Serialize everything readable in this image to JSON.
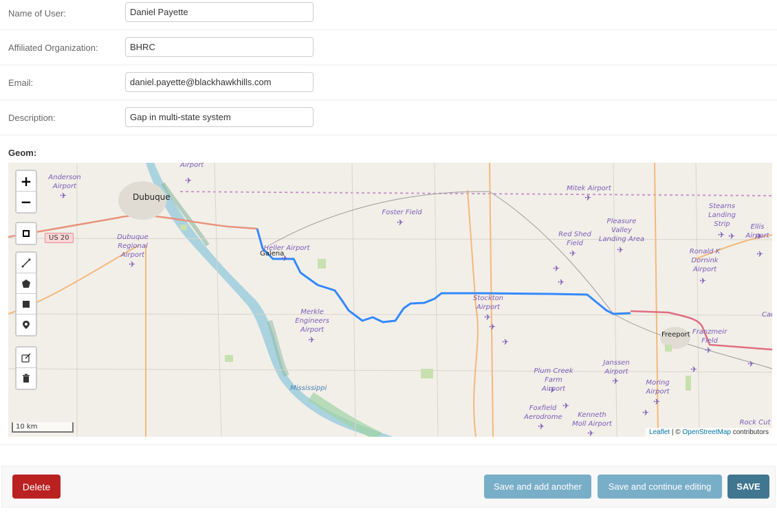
{
  "form": {
    "name": {
      "label": "Name of User:",
      "value": "Daniel Payette"
    },
    "org": {
      "label": "Affiliated Organization:",
      "value": "BHRC"
    },
    "email": {
      "label": "Email:",
      "value": "daniel.payette@blackhawkhills.com"
    },
    "description": {
      "label": "Description:",
      "value": "Gap in multi-state system"
    },
    "geom_label": "Geom:"
  },
  "map": {
    "controls": {
      "zoom_in": "+",
      "zoom_out": "−",
      "icons": [
        "rectangle-outline-icon",
        "draw-polyline-icon",
        "draw-polygon-icon",
        "draw-rectangle-icon",
        "draw-marker-icon",
        "edit-layers-icon",
        "delete-layers-icon"
      ]
    },
    "route_color": "#3388ff",
    "cities": {
      "dubuque": "Dubuque",
      "freeport": "Freeport",
      "galena": "Galena"
    },
    "road_shield": "US 20",
    "river": "Mississippi",
    "places": {
      "anderson": "Anderson Airport",
      "dubuque_regional": "Dubuque Regional Airport",
      "heller": "Heller Airport",
      "foster": "Foster Field",
      "mitek": "Mitek Airport",
      "stearns": "Stearns Landing Strip",
      "ellis": "Ellis Airport",
      "red_shed": "Red Shed Field",
      "pleasure_valley": "Pleasure Valley Landing Area",
      "ronald": "Ronald K Dornink Airport",
      "merkle": "Merkle Engineers Airport",
      "stockton": "Stockton Airport",
      "franzmeir": "Franzmeir Field",
      "car": "Car",
      "plum_creek": "Plum Creek Farm Airport",
      "jansen": "Janssen Airport",
      "moring": "Moring Airport",
      "foxfield": "Foxfield Aerodrome",
      "kenneth": "Kenneth Moll Airport",
      "rock_cut": "Rock Cut",
      "top_airport": "Airport"
    },
    "scale": "10 km",
    "attribution": {
      "leaflet": "Leaflet",
      "sep": " | © ",
      "osm": "OpenStreetMap",
      "suffix": " contributors"
    }
  },
  "actions": {
    "delete": "Delete",
    "save_add": "Save and add another",
    "save_continue": "Save and continue editing",
    "save": "SAVE"
  }
}
